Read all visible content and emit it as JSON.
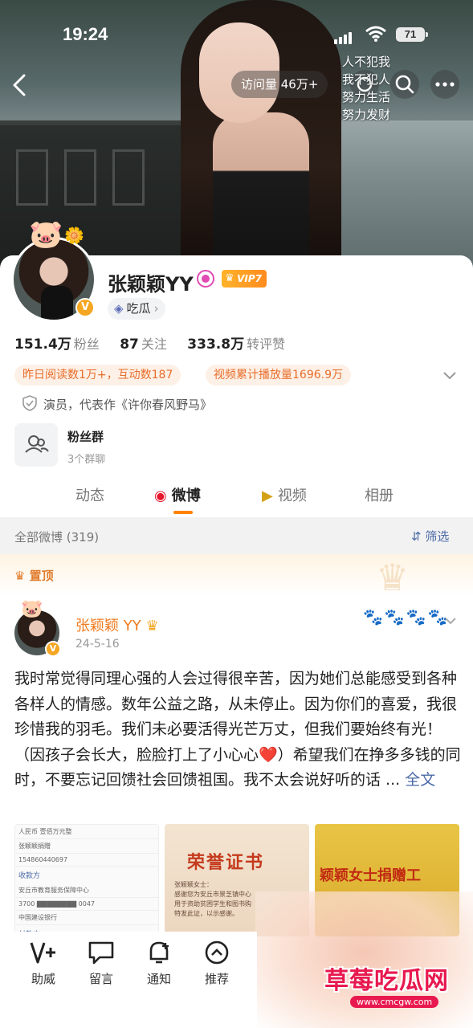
{
  "status_bar": {
    "time": "19:24",
    "battery": "71"
  },
  "header": {
    "visits": "访问量 46万+",
    "quote_lines": [
      "人不犯我",
      "我不犯人",
      "努力生活",
      "努力发财"
    ]
  },
  "profile": {
    "name": "张颖颖YY",
    "vip": "VIP7",
    "tag": "吃瓜",
    "stats": [
      {
        "value": "151.4万",
        "label": "粉丝"
      },
      {
        "value": "87",
        "label": "关注"
      },
      {
        "value": "333.8万",
        "label": "转评赞"
      }
    ],
    "pills": [
      "昨日阅读数1万+，互动数187",
      "视频累计播放量1696.9万"
    ],
    "bio": "演员，代表作《许你春风野马》",
    "group": {
      "title": "粉丝群",
      "sub": "3个群聊"
    }
  },
  "tabs": [
    "动态",
    "微博",
    "视频",
    "相册"
  ],
  "filter": {
    "left": "全部微博 (319)",
    "right": "筛选"
  },
  "pinned_label": "置顶",
  "post": {
    "author": "张颖颖 YY",
    "date": "24-5-16",
    "text": "我时常觉得同理心强的人会过得很辛苦，因为她们总能感受到各种各样人的情感。数年公益之路，从未停止。因为你们的喜爱，我很珍惜我的羽毛。我们未必要活得光芒万丈，但我们要始终有光！（因孩子会长大，脸脸打上了小心心❤️）希望我们在挣多多钱的同时，不要忘记回馈社会回馈祖国。我不太会说好听的话 ... ",
    "more": "全文",
    "thumb1_rows": [
      "人民币 壹佰万元整",
      "张颖颖捐赠",
      "154860440697",
      "收款方",
      "安丘市教育服务保障中心",
      "3700 ▇▇▇▇▇▇▇▇ 0047",
      "中国建设银行",
      "付款方"
    ],
    "thumb2_title": "荣誉证书",
    "thumb2_lines": [
      "张颖颖女士：",
      "感谢您为安丘市景芝镇中心",
      "用于资助贫困学生和图书购",
      "特发此证，以示感谢。"
    ],
    "thumb3_text": "颖颖女士捐赠工"
  },
  "bottom_bar": [
    "助威",
    "留言",
    "通知",
    "推荐"
  ],
  "watermark": {
    "text": "草莓吃瓜网",
    "url": "www.cmcgw.com"
  },
  "colors": {
    "accent": "#ff8200",
    "link": "#4b6aa6",
    "pill_text": "#e86d2a",
    "author": "#f07b1f"
  }
}
